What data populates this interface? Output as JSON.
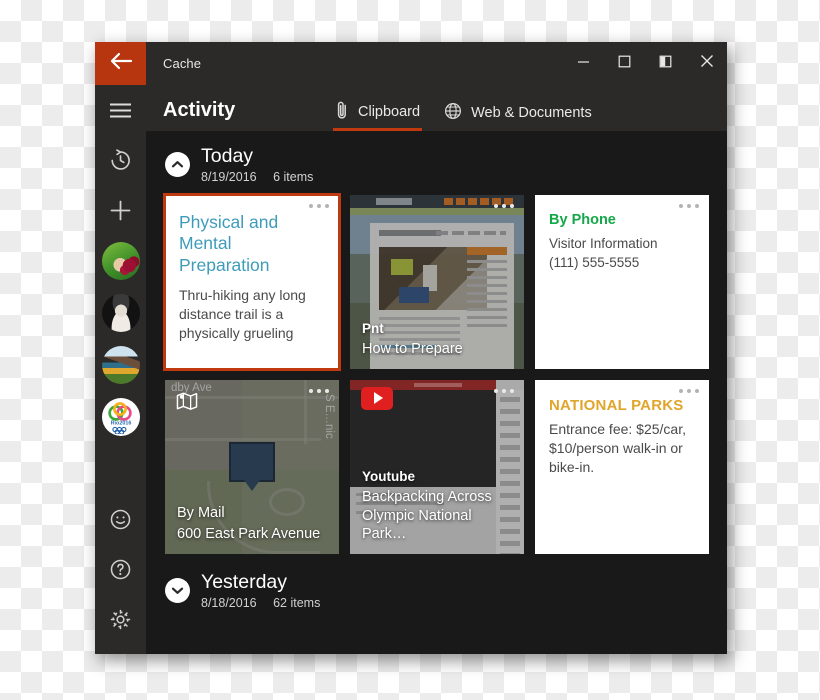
{
  "window": {
    "title": "Cache",
    "back_icon": "back-arrow-icon",
    "controls": {
      "minimize": "minimize-icon",
      "maximize": "maximize-icon",
      "split": "split-view-icon",
      "close": "close-icon"
    }
  },
  "rail": {
    "menu_icon": "hamburger-menu-icon",
    "history_icon": "history-clock-icon",
    "add_icon": "plus-icon",
    "avatars": [
      {
        "name": "avatar-berries",
        "alt": "Hands holding raspberries"
      },
      {
        "name": "avatar-portrait",
        "alt": "Black and white portrait"
      },
      {
        "name": "avatar-landscape",
        "alt": "Autumn mountain landscape"
      },
      {
        "name": "avatar-rio2016",
        "alt": "Rio 2016 Olympics logo",
        "caption": "Rio2016"
      }
    ],
    "feedback_icon": "smiley-face-icon",
    "help_icon": "question-mark-icon",
    "settings_icon": "gear-icon"
  },
  "header": {
    "section_title": "Activity",
    "tabs": [
      {
        "label": "Clipboard",
        "icon": "paperclip-icon",
        "active": true
      },
      {
        "label": "Web & Documents",
        "icon": "globe-icon",
        "active": false
      }
    ]
  },
  "accent": {
    "orange": "#c0390f",
    "back_button": "#b8360f",
    "teal": "#3e9cb9",
    "green": "#15a84a",
    "gold": "#e0a52b",
    "youtube_red": "#e02020"
  },
  "groups": [
    {
      "title": "Today",
      "date": "8/19/2016",
      "count": "6 items",
      "expanded": true,
      "chevron": "chevron-up-icon"
    },
    {
      "title": "Yesterday",
      "date": "8/18/2016",
      "count": "62 items",
      "expanded": false,
      "chevron": "chevron-down-icon"
    }
  ],
  "cards": [
    {
      "kind": "text",
      "selected": true,
      "heading": "Physical and Mental Preparation",
      "heading_style": "teal",
      "body": "Thru-hiking any long distance trail is a physically grueling"
    },
    {
      "kind": "web",
      "selected": false,
      "source": "Pnt",
      "title": "How to Prepare"
    },
    {
      "kind": "text",
      "selected": false,
      "heading": "By Phone",
      "heading_style": "green",
      "line1": "Visitor Information",
      "line2": "(111) 555-5555"
    },
    {
      "kind": "map",
      "selected": false,
      "icon": "map-icon",
      "source": "By Mail",
      "title": "600 East Park Avenue",
      "street_top": "dby Ave",
      "street_right": "S E…nic"
    },
    {
      "kind": "youtube",
      "selected": false,
      "source": "Youtube",
      "title": "Backpacking Across Olympic National Park…"
    },
    {
      "kind": "text",
      "selected": false,
      "heading": "NATIONAL PARKS",
      "heading_style": "gold",
      "body": "Entrance fee: $25/car, $10/person walk-in or bike-in."
    }
  ]
}
